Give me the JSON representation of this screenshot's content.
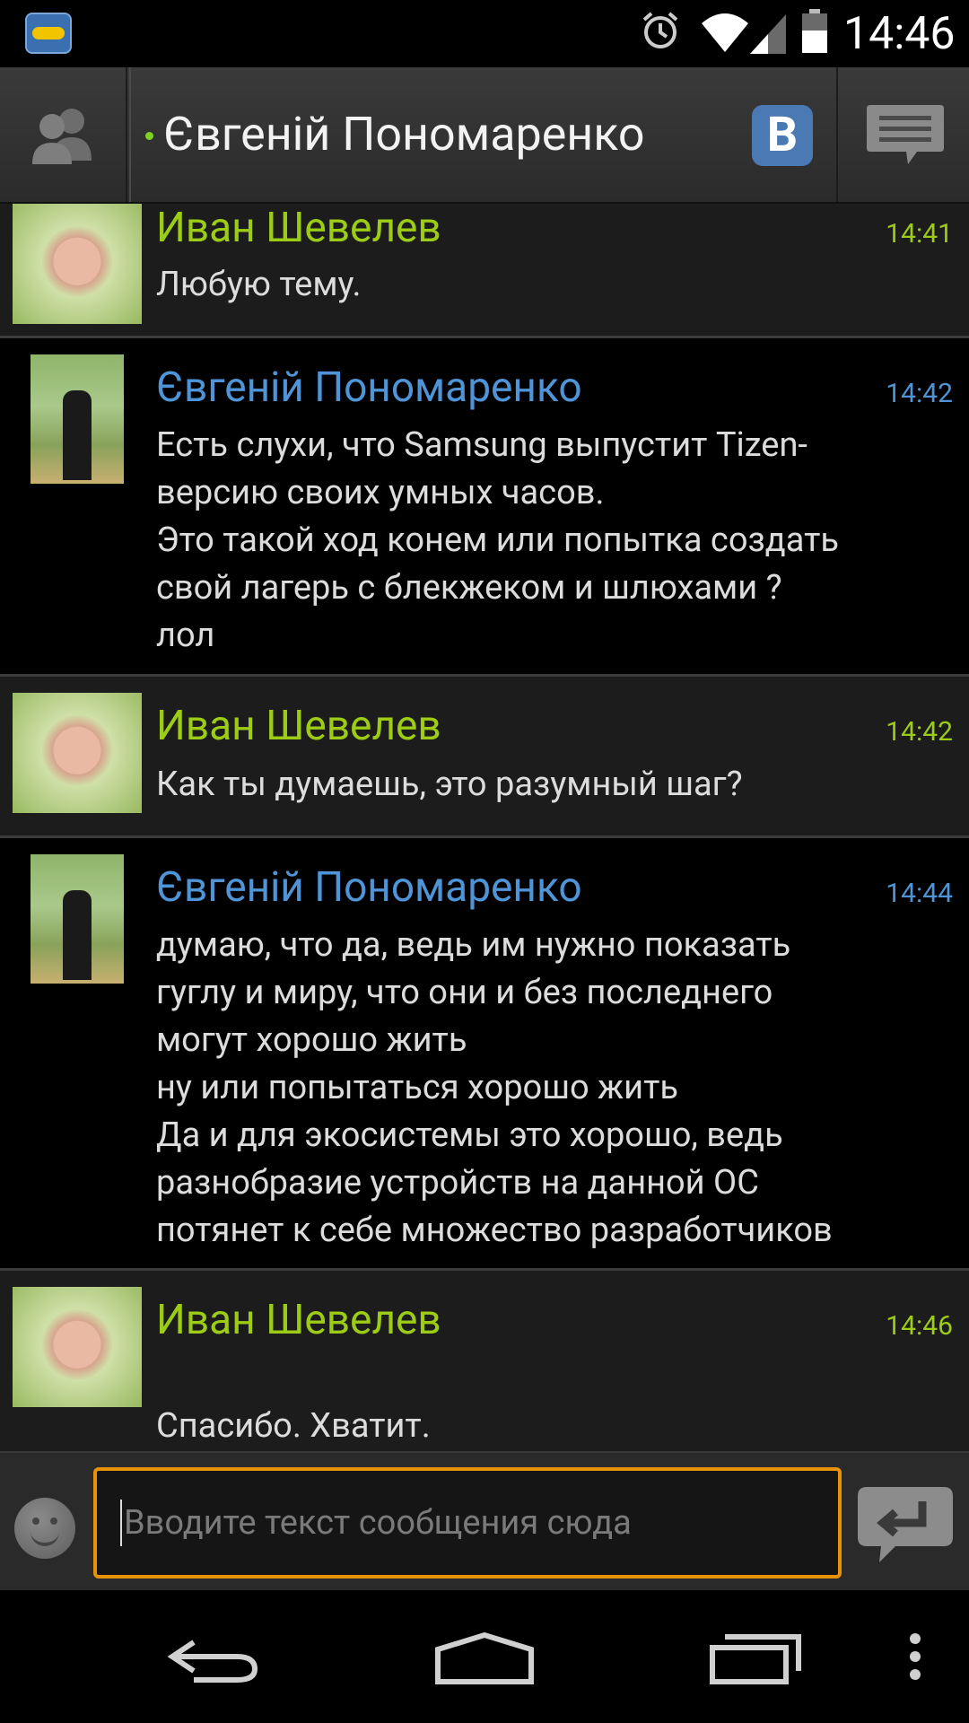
{
  "status_bar": {
    "time": "14:46",
    "icons": [
      "app-im-icon",
      "alarm-icon",
      "wifi-icon",
      "signal-icon",
      "battery-icon"
    ]
  },
  "header": {
    "contact_name": "Євгеній Пономаренко",
    "network_badge": "В",
    "online": true
  },
  "messages": [
    {
      "sender": "Иван Шевелев",
      "time": "14:41",
      "text": "Любую тему.",
      "direction": "incoming"
    },
    {
      "sender": "Євгеній Пономаренко",
      "time": "14:42",
      "text": "Есть слухи, что Samsung выпустит Tizen-\nверсию своих умных часов.\nЭто такой ход конем или попытка создать\nсвой лагерь с блекжеком и шлюхами ?\nлол",
      "direction": "outgoing"
    },
    {
      "sender": "Иван Шевелев",
      "time": "14:42",
      "text": "Как ты думаешь, это разумный шаг?",
      "direction": "incoming"
    },
    {
      "sender": "Євгеній Пономаренко",
      "time": "14:44",
      "text": "думаю, что да, ведь им нужно показать\nгуглу и миру, что они и без последнего\nмогут хорошо жить\nну или попытаться хорошо жить\nДа и для экосистемы это хорошо, ведь\nразнобразие устройств на данной ОС\nпотянет к себе множество разработчиков",
      "direction": "outgoing"
    },
    {
      "sender": "Иван Шевелев",
      "time": "14:46",
      "text": "Спасибо. Хватит.",
      "direction": "incoming",
      "emoticon": "smiley-icon"
    }
  ],
  "input": {
    "placeholder": "Вводите текст сообщения сюда",
    "value": ""
  },
  "colors": {
    "incoming_name": "#9ccc16",
    "outgoing_name": "#4f94d6",
    "input_border": "#e8920a"
  }
}
